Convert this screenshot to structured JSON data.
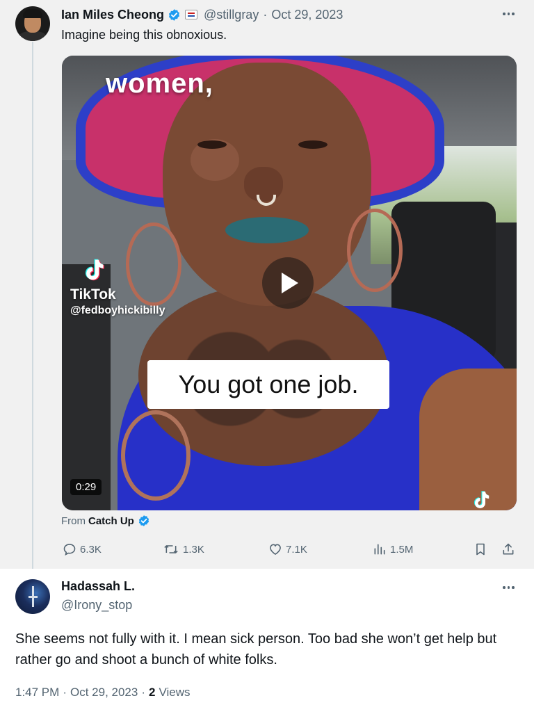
{
  "quoted_tweet": {
    "author_name": "Ian Miles Cheong",
    "author_handle": "@stillgray",
    "separator": "·",
    "date": "Oct 29, 2023",
    "text": "Imagine being this obnoxious.",
    "media": {
      "caption_top": "women,",
      "platform_name": "TikTok",
      "platform_user": "@fedboyhickibilly",
      "caption_middle": "You got one job.",
      "duration": "0:29"
    },
    "source_prefix": "From",
    "source_name": "Catch Up",
    "stats": {
      "replies": "6.3K",
      "reposts": "1.3K",
      "likes": "7.1K",
      "views": "1.5M"
    }
  },
  "reply": {
    "author_name": "Hadassah L.",
    "author_handle": "@Irony_stop",
    "text": "She seems not fully with it. I mean sick person. Too bad she won’t get help but rather go and shoot a bunch of white folks.",
    "time": "1:47 PM",
    "separator": "·",
    "date": "Oct 29, 2023",
    "separator2": "·",
    "views_count": "2",
    "views_label": "Views"
  },
  "colors": {
    "quoted_background": "#f1f1f1",
    "verified_blue": "#1d9bf0",
    "secondary_text": "#536471"
  }
}
